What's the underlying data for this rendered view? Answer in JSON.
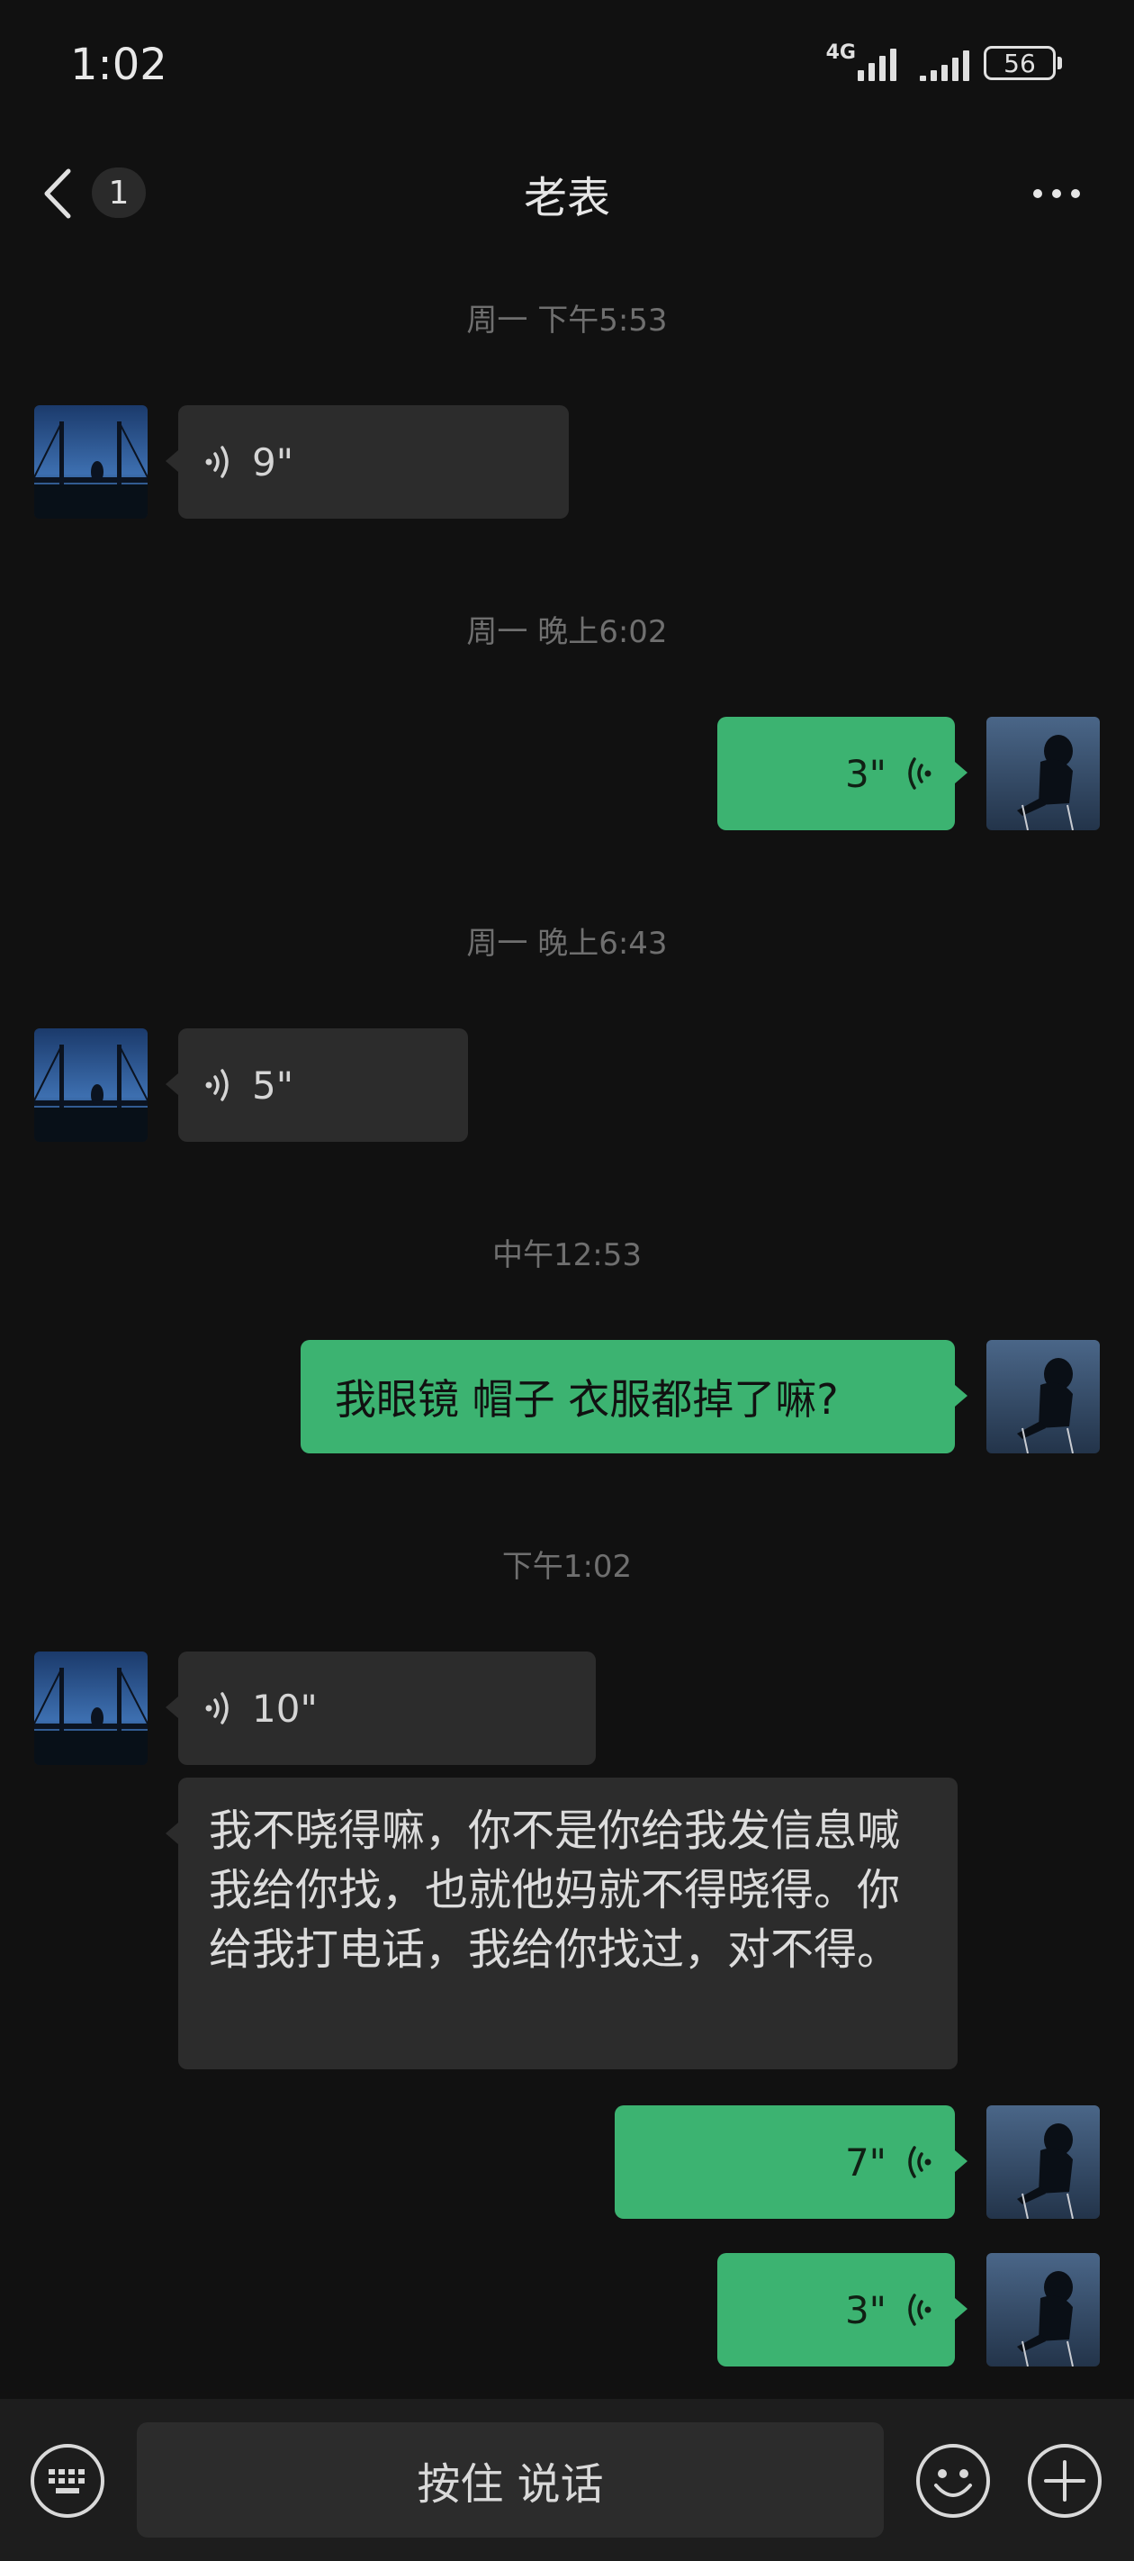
{
  "status_bar": {
    "time": "1:02",
    "network": "4G",
    "battery": "56"
  },
  "nav": {
    "back_count": "1",
    "title": "老表"
  },
  "messages": {
    "ts1": "周一 下午5:53",
    "m1_duration": "9\"",
    "ts2": "周一 晚上6:02",
    "m2_duration": "3\"",
    "ts3": "周一 晚上6:43",
    "m3_duration": "5\"",
    "ts4": "中午12:53",
    "m4_text": "我眼镜 帽子 衣服都掉了嘛?",
    "ts5": "下午1:02",
    "m5_duration": "10\"",
    "m6_text": "我不晓得嘛，你不是你给我发信息喊我给你找，也就他妈就不得晓得。你给我打电话，我给你找过，对不得。",
    "m7_duration": "7\"",
    "m8_duration": "3\""
  },
  "input_bar": {
    "hold_to_talk": "按住 说话"
  },
  "icons": {
    "back": "chevron-left-icon",
    "more": "more-dots-icon",
    "keyboard": "keyboard-icon",
    "emoji": "emoji-icon",
    "plus": "plus-icon",
    "voice_in": "voice-wave-icon",
    "voice_out": "voice-wave-icon"
  },
  "colors": {
    "background": "#111111",
    "bubble_in": "#2c2c2c",
    "bubble_out": "#3cb371",
    "timestamp": "#6f6f6f"
  }
}
